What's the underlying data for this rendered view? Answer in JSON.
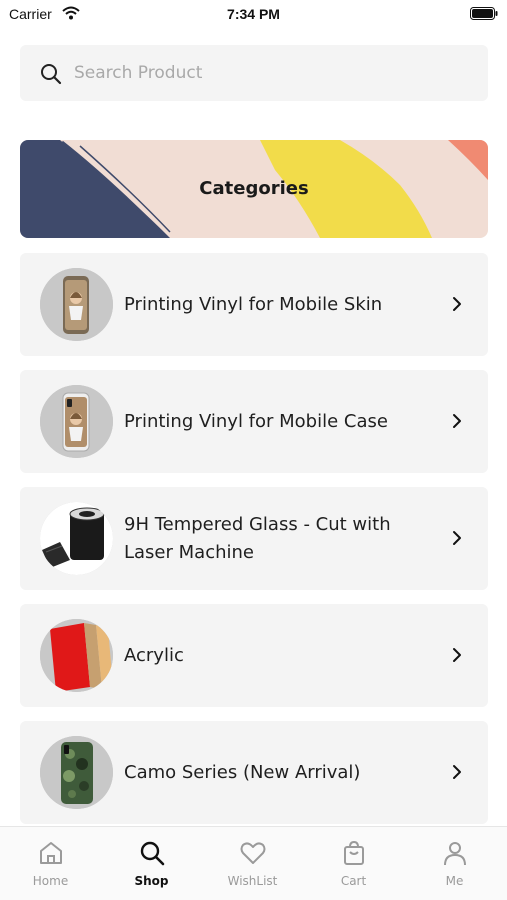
{
  "status_bar": {
    "carrier": "Carrier",
    "time": "7:34 PM"
  },
  "search": {
    "placeholder": "Search Product",
    "icon": "search-icon"
  },
  "banner": {
    "title": "Categories"
  },
  "categories": [
    {
      "label": "Printing Vinyl for Mobile Skin",
      "thumb": "phone-skin-image"
    },
    {
      "label": "Printing Vinyl for Mobile Case",
      "thumb": "phone-case-image"
    },
    {
      "label": "9H Tempered Glass - Cut with Laser Machine",
      "thumb": "tempered-glass-roll-image"
    },
    {
      "label": "Acrylic",
      "thumb": "acrylic-sheets-image"
    },
    {
      "label": "Camo Series (New Arrival)",
      "thumb": "camo-phone-image"
    }
  ],
  "tab_bar": {
    "tabs": [
      {
        "label": "Home",
        "icon": "home-icon",
        "active": false
      },
      {
        "label": "Shop",
        "icon": "search-icon",
        "active": true
      },
      {
        "label": "WishList",
        "icon": "heart-icon",
        "active": false
      },
      {
        "label": "Cart",
        "icon": "cart-icon",
        "active": false
      },
      {
        "label": "Me",
        "icon": "user-icon",
        "active": false
      }
    ]
  },
  "colors": {
    "card_bg": "#f4f4f4",
    "banner_bg": "#f1ddd4",
    "banner_navy": "#3f4a6b",
    "banner_yellow": "#f2dc4a",
    "banner_coral": "#f08a72"
  }
}
